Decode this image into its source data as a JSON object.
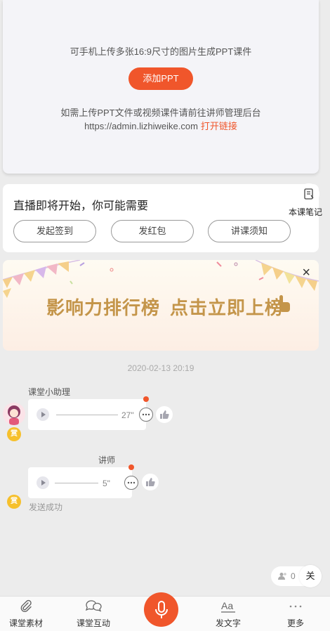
{
  "upload_card": {
    "hint": "可手机上传多张16:9尺寸的图片生成PPT课件",
    "add_button": "添加PPT",
    "manage_hint": "如需上传PPT文件或视频课件请前往讲师管理后台",
    "admin_url": "https://admin.lizhiweike.com",
    "open_link": "打开链接"
  },
  "notice_card": {
    "title": "直播即将开始，你可能需要",
    "buttons": [
      "发起签到",
      "发红包",
      "讲课须知"
    ],
    "notes_label": "本课笔记"
  },
  "banner": {
    "text_left": "影响力排行榜",
    "text_right": "点击立即上榜",
    "close": "×"
  },
  "timestamp": "2020-02-13 20:19",
  "messages": [
    {
      "sender": "课堂小助理",
      "duration": "27\"",
      "reward": "赏"
    },
    {
      "sender": "讲师",
      "duration": "5\"",
      "reward": "赏",
      "status": "发送成功"
    }
  ],
  "online": {
    "count": "0",
    "close": "关"
  },
  "toolbar": {
    "items": [
      "课堂素材",
      "课堂互动",
      "发文字",
      "更多"
    ]
  },
  "colors": {
    "accent": "#f0562b",
    "banner_text": "#c4954a"
  }
}
